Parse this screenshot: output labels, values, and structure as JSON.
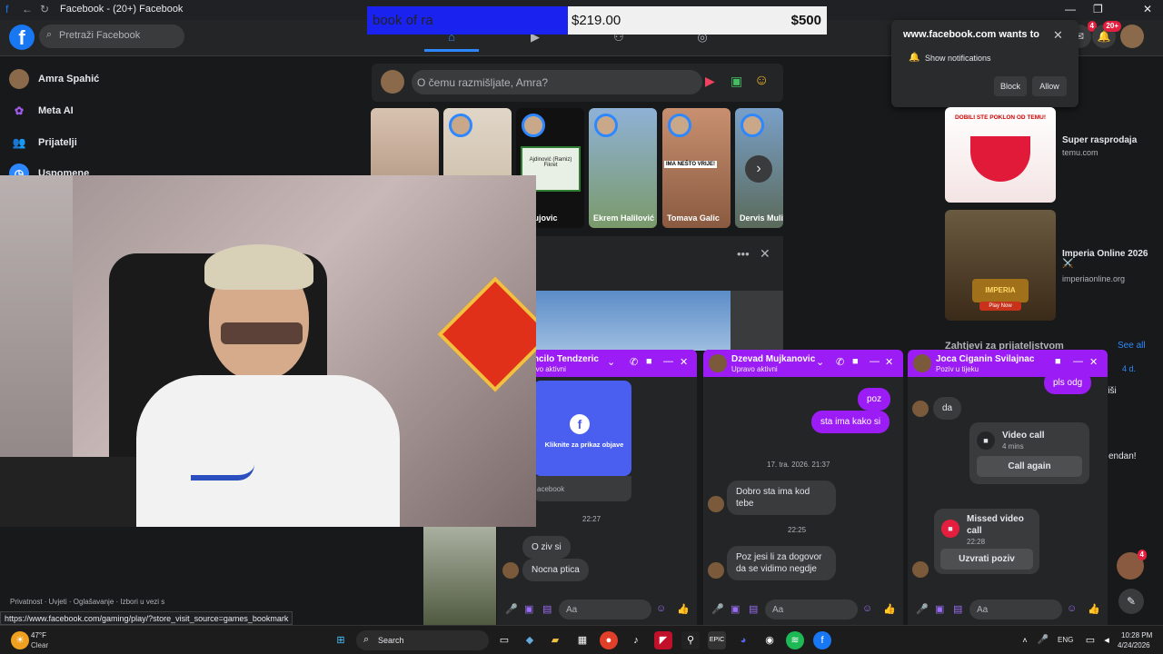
{
  "browser": {
    "tab_title": "Facebook - (20+) Facebook",
    "status_url": "https://www.facebook.com/gaming/play/?store_visit_source=games_bookmark"
  },
  "overlay": {
    "name": "book of ra",
    "balance": "$219.00",
    "target": "$500"
  },
  "header": {
    "search_placeholder": "Pretraži Facebook",
    "messenger_badge": "4",
    "notif_badge": "20+"
  },
  "sidebar": {
    "items": [
      {
        "label": "Amra Spahić",
        "icon": "avatar"
      },
      {
        "label": "Meta AI",
        "icon": "meta-ai-icon"
      },
      {
        "label": "Prijatelji",
        "icon": "friends-icon"
      },
      {
        "label": "Uspomene",
        "icon": "clock-icon"
      }
    ],
    "footer": "Privatnost · Uvjeti · Oglašavanje · Izbori u vezi s"
  },
  "composer": {
    "placeholder": "O čemu razmišljate, Amra?"
  },
  "stories": [
    {
      "name": ""
    },
    {
      "name": ""
    },
    {
      "name": "o Kujovic"
    },
    {
      "name": "Ekrem Halilović"
    },
    {
      "name": "Tomava Galic"
    },
    {
      "name": "Dervis Muli"
    }
  ],
  "story_text": {
    "sign": "Ajdinović (Ramiz) Fikret",
    "overlay": "IMA NEŠTO VRIJE!"
  },
  "notification_prompt": {
    "title": "www.facebook.com wants to",
    "item": "Show notifications",
    "block": "Block",
    "allow": "Allow"
  },
  "ads": [
    {
      "title": "Super rasprodaja",
      "url": "temu.com",
      "banner_text": "DOBILI STE POKLON OD TEMU!"
    },
    {
      "title": "Imperia Online 2026 ⚔️",
      "url": "imperiaonline.org",
      "banner_text": "Play Now"
    }
  ],
  "friend_requests": {
    "title": "Zahtjevi za prijateljstvom",
    "see_all": "See all",
    "age": "4 d.",
    "delete": "riši",
    "birthday_fragment": "endan!"
  },
  "chats": [
    {
      "name": "omcilo Tendzeric",
      "status": "pravo aktivni",
      "card_text": "Kliknite za prikaz objave",
      "card_source": "acebook",
      "time": "22:27",
      "messages": [
        {
          "dir": "in",
          "text": "O ziv si"
        },
        {
          "dir": "in",
          "text": "Nocna ptica"
        }
      ]
    },
    {
      "name": "Dzevad Mujkanovic",
      "status": "Upravo aktivni",
      "messages": [
        {
          "dir": "out",
          "text": "poz"
        },
        {
          "dir": "out",
          "text": "sta ima kako si"
        },
        {
          "dir": "ts",
          "text": "17. tra. 2026. 21:37"
        },
        {
          "dir": "in",
          "text": "Dobro sta ima kod tebe"
        },
        {
          "dir": "ts",
          "text": "22:25"
        },
        {
          "dir": "in",
          "text": "Poz jesi li za dogovor da se vidimo negdje"
        }
      ]
    },
    {
      "name": "Joca Ciganin Svilajnac",
      "status": "Poziv u tijeku",
      "messages": [
        {
          "dir": "out",
          "text": "pls odg"
        },
        {
          "dir": "in",
          "text": "da"
        }
      ],
      "video_call": {
        "title": "Video call",
        "duration": "4 mins",
        "button": "Call again"
      },
      "missed_call": {
        "title": "Missed video call",
        "time": "22:28",
        "button": "Uzvrati poziv"
      }
    }
  ],
  "chat_input_placeholder": "Aa",
  "chat_head_badge": "4",
  "taskbar": {
    "weather_temp": "47°F",
    "weather_text": "Clear",
    "search_label": "Search",
    "lang": "ENG",
    "time": "10:28 PM",
    "date": "4/24/2026"
  },
  "colors": {
    "fb_blue": "#1877f2",
    "chat_header": "#9b1cf5",
    "accent": "#2d88ff"
  }
}
